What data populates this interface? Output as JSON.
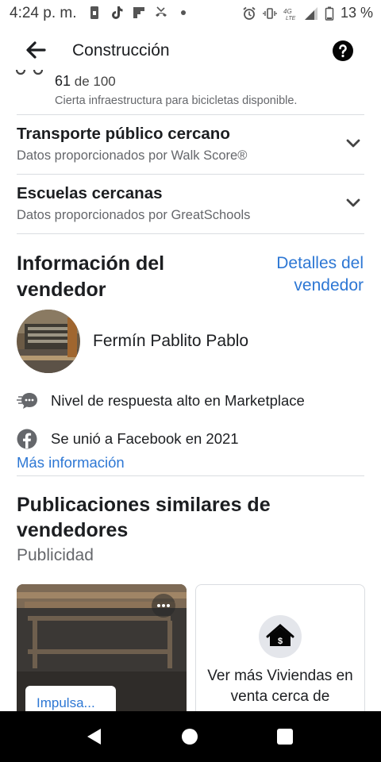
{
  "status_bar": {
    "time": "4:24 p. m.",
    "battery": "13 %",
    "left_icons": [
      "sim-icon",
      "tiktok-icon",
      "flipboard-icon",
      "missed-call-icon",
      "dot-icon"
    ],
    "right_icons": [
      "alarm-icon",
      "vibrate-icon",
      "4g-lte-icon",
      "signal-icon",
      "battery-icon"
    ]
  },
  "header": {
    "title": "Construcción",
    "back_icon": "arrow-left-icon",
    "help_icon": "question-mark-icon"
  },
  "bike_score": {
    "value": "61",
    "of_label": "de 100",
    "description": "Cierta infraestructura para bicicletas disponible."
  },
  "sections": [
    {
      "title": "Transporte público cercano",
      "subtitle": "Datos proporcionados por Walk Score®"
    },
    {
      "title": "Escuelas cercanas",
      "subtitle": "Datos proporcionados por GreatSchools"
    }
  ],
  "seller": {
    "heading": "Información del vendedor",
    "details_link": "Detalles del vendedor",
    "name": "Fermín Pablito Pablo",
    "response_rate": "Nivel de respuesta alto en Marketplace",
    "joined": "Se unió a Facebook en 2021",
    "more_info_link": "Más información"
  },
  "similar": {
    "heading": "Publicaciones similares de vendedores",
    "ad_label": "Publicidad",
    "card_boost_label": "Impulsa...",
    "more_listings_text": "Ver más Viviendas en venta cerca de"
  },
  "colors": {
    "link": "#2d77d4",
    "secondary_text": "#65676b",
    "divider": "#dadde1"
  }
}
